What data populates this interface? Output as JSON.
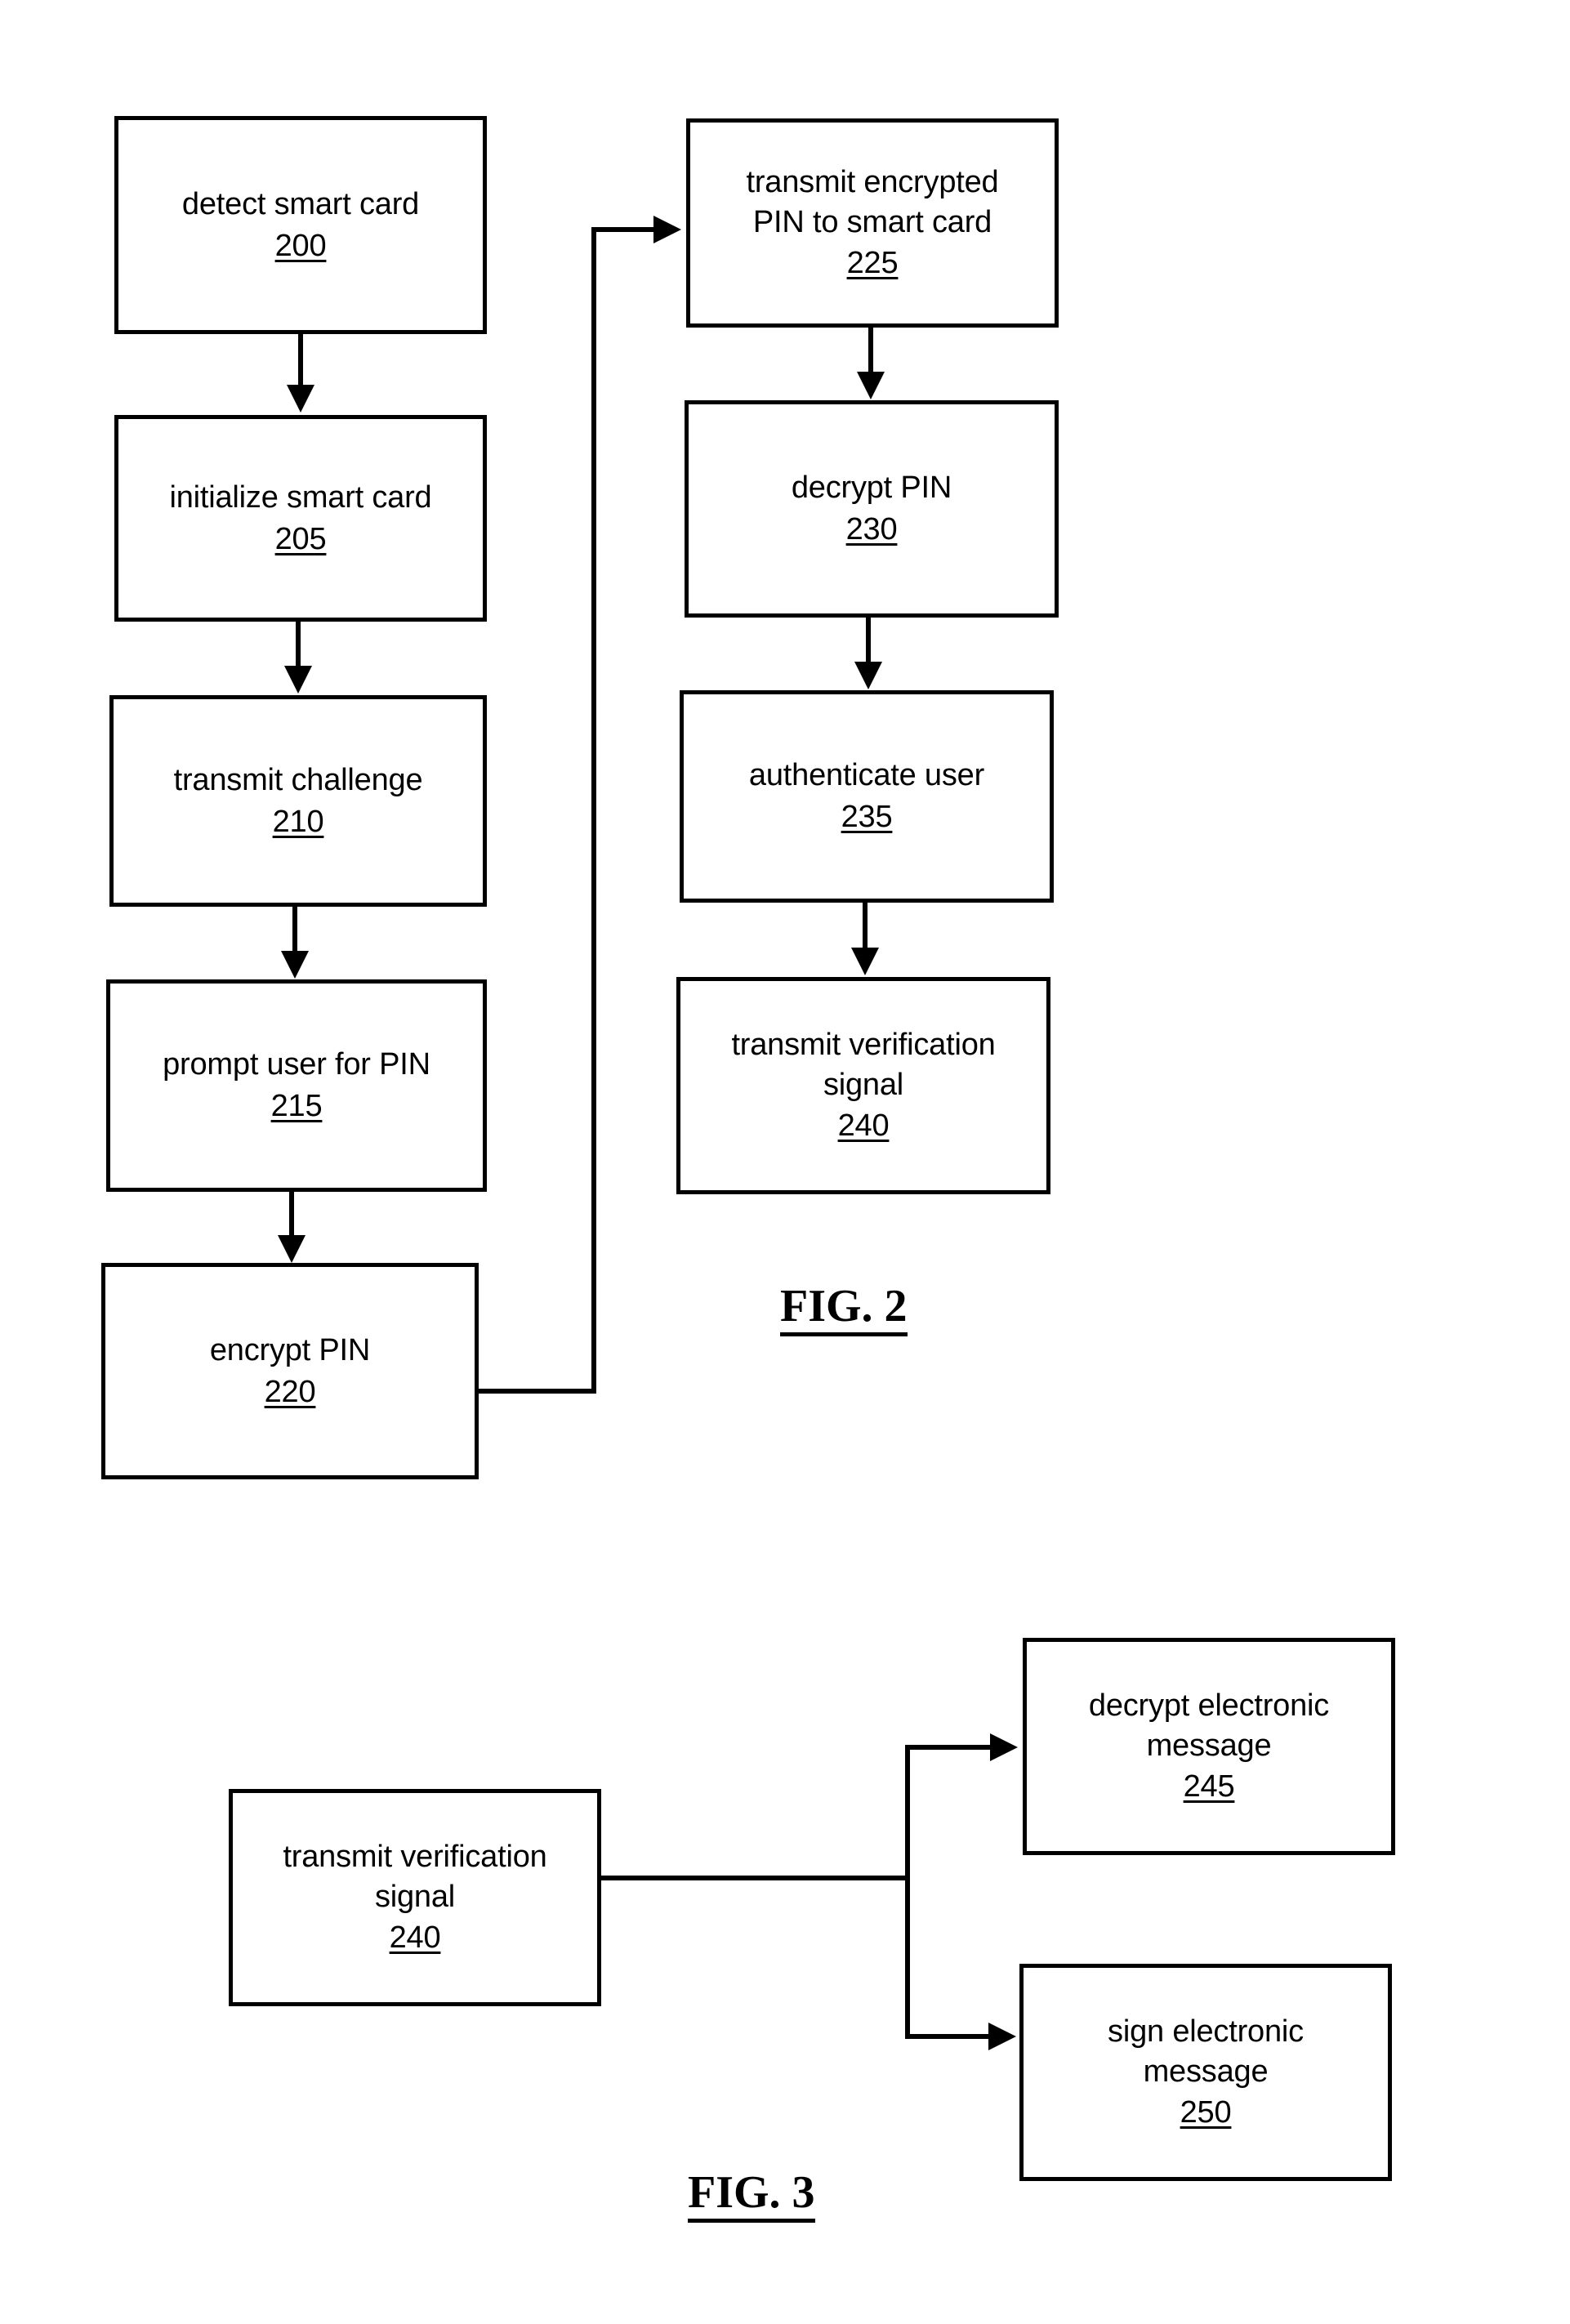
{
  "document": {
    "type": "patent-flowchart",
    "background_color": "#ffffff",
    "line_color": "#000000"
  },
  "figures": [
    {
      "id": "fig2",
      "caption": "FIG. 2",
      "steps": [
        {
          "id": "s200",
          "label": "detect smart card",
          "ref": "200"
        },
        {
          "id": "s205",
          "label": "initialize smart card",
          "ref": "205"
        },
        {
          "id": "s210",
          "label": "transmit challenge",
          "ref": "210"
        },
        {
          "id": "s215",
          "label": "prompt user for PIN",
          "ref": "215"
        },
        {
          "id": "s220",
          "label": "encrypt PIN",
          "ref": "220"
        },
        {
          "id": "s225",
          "label": "transmit encrypted\nPIN to smart card",
          "ref": "225"
        },
        {
          "id": "s230",
          "label": "decrypt PIN",
          "ref": "230"
        },
        {
          "id": "s235",
          "label": "authenticate user",
          "ref": "235"
        },
        {
          "id": "s240",
          "label": "transmit verification\nsignal",
          "ref": "240"
        }
      ]
    },
    {
      "id": "fig3",
      "caption": "FIG. 3",
      "steps": [
        {
          "id": "f3-240",
          "label": "transmit verification\nsignal",
          "ref": "240"
        },
        {
          "id": "f3-245",
          "label": "decrypt electronic\nmessage",
          "ref": "245"
        },
        {
          "id": "f3-250",
          "label": "sign electronic\nmessage",
          "ref": "250"
        }
      ]
    }
  ]
}
